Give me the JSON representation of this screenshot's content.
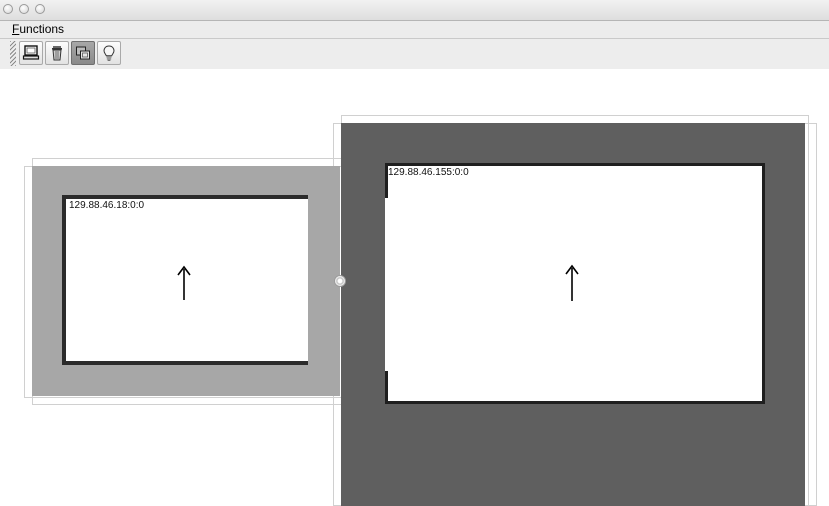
{
  "window": {
    "controls": [
      "close-icon",
      "minimize-icon",
      "zoom-icon"
    ]
  },
  "menubar": {
    "functions_label": "Functions",
    "functions_mnemonic": "F",
    "functions_rest": "unctions"
  },
  "toolbar": {
    "buttons": [
      {
        "icon": "computer-icon",
        "active": false
      },
      {
        "icon": "trash-icon",
        "active": false
      },
      {
        "icon": "overlap-windows-icon",
        "active": true
      },
      {
        "icon": "lightbulb-icon",
        "active": false
      }
    ]
  },
  "screens": [
    {
      "label": "129.88.46.18:0:0",
      "arrow": "↑",
      "background": "#a7a7a7"
    },
    {
      "label": "129.88.46.155:0:0",
      "arrow": "↑",
      "background": "#5f5f5f"
    }
  ],
  "colors": {
    "screen_face": "#ffffff",
    "bezel": "#2b2b2b"
  }
}
